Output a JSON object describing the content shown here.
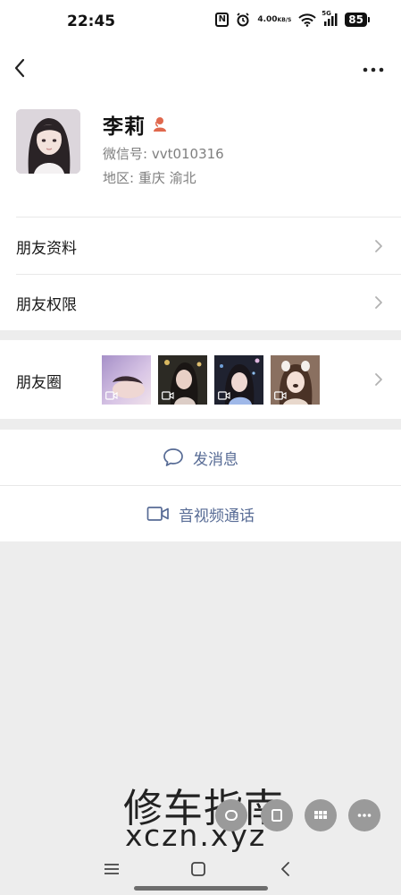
{
  "status_bar": {
    "time": "22:45",
    "nfc": "N",
    "net_speed_value": "4.00",
    "net_speed_unit": "KB/S",
    "signal": "5G",
    "battery": "85"
  },
  "header": {
    "back_icon": "chevron-left-icon",
    "more_icon": "more-dots-icon"
  },
  "profile": {
    "name": "李莉",
    "gender_icon": "female-user-icon",
    "wechat_id": "微信号: vvt010316",
    "region": "地区: 重庆  渝北"
  },
  "menu": {
    "friend_info": "朋友资料",
    "friend_permissions": "朋友权限",
    "moments": "朋友圈"
  },
  "actions": {
    "send_message": "发消息",
    "video_call": "音视频通话"
  },
  "watermark": {
    "cn": "修车指南",
    "en": "xczn.xyz"
  },
  "colors": {
    "link": "#576b95",
    "gender_badge": "#e0684d",
    "page_bg": "#ededed"
  }
}
